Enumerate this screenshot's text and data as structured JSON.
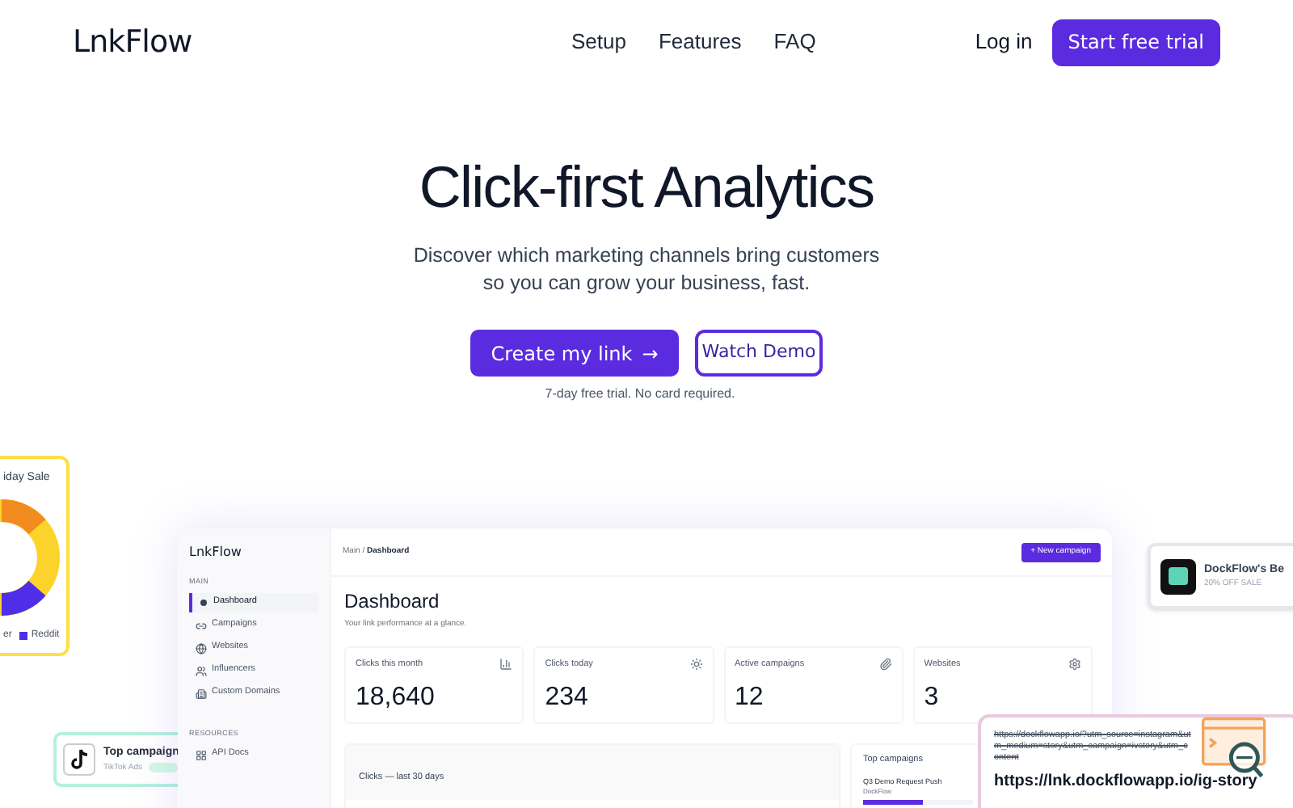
{
  "nav": {
    "logo": "LnkFlow",
    "links": [
      {
        "label": "Setup"
      },
      {
        "label": "Features"
      },
      {
        "label": "FAQ"
      }
    ],
    "login": "Log in",
    "cta": "Start free trial"
  },
  "hero": {
    "title": "Click-first Analytics",
    "subtitle": "Discover which marketing channels bring customers so you can grow your business, fast.",
    "primary_button": "Create my link",
    "primary_arrow": "→",
    "secondary_button": "Watch Demo",
    "note": "7-day free trial. No card required."
  },
  "sale_card": {
    "title": "iday Sale",
    "legend": [
      {
        "label": "er"
      },
      {
        "label": "Reddit",
        "color": "#4f2ee8"
      }
    ]
  },
  "tiktok_card": {
    "title": "Top campaign",
    "subtitle": "TikTok Ads"
  },
  "promo_card": {
    "title": "DockFlow's Be",
    "subtitle": "20% OFF SALE"
  },
  "url_card": {
    "long_url": "https://dockflowapp.io/?utm_source=instagram&utm_medium=story&utm_campaign=ivstory&utm_content",
    "short_url": "https://lnk.dockflowapp.io/ig-story"
  },
  "dashboard": {
    "logo": "LnkFlow",
    "sections": [
      {
        "heading": "MAIN",
        "items": [
          {
            "label": "Dashboard",
            "selected": true
          },
          {
            "label": "Campaigns",
            "selected": false
          },
          {
            "label": "Websites",
            "selected": false
          },
          {
            "label": "Influencers",
            "selected": false
          },
          {
            "label": "Custom Domains",
            "selected": false
          }
        ]
      },
      {
        "heading": "RESOURCES",
        "items": [
          {
            "label": "API Docs",
            "selected": false
          }
        ]
      }
    ],
    "breadcrumb_parent": "Main /",
    "breadcrumb_current": "Dashboard",
    "new_button": "+ New campaign",
    "title": "Dashboard",
    "subtitle": "Your link performance at a glance.",
    "stats": [
      {
        "label": "Clicks this month",
        "value": "18,640"
      },
      {
        "label": "Clicks today",
        "value": "234"
      },
      {
        "label": "Active campaigns",
        "value": "12"
      },
      {
        "label": "Websites",
        "value": "3"
      }
    ],
    "chart_title": "Clicks — last 30 days",
    "top_title": "Top campaigns",
    "top_campaigns": [
      {
        "name": "Q3 Demo Request Push",
        "org": "DockFlow",
        "level": 0.55
      }
    ]
  }
}
